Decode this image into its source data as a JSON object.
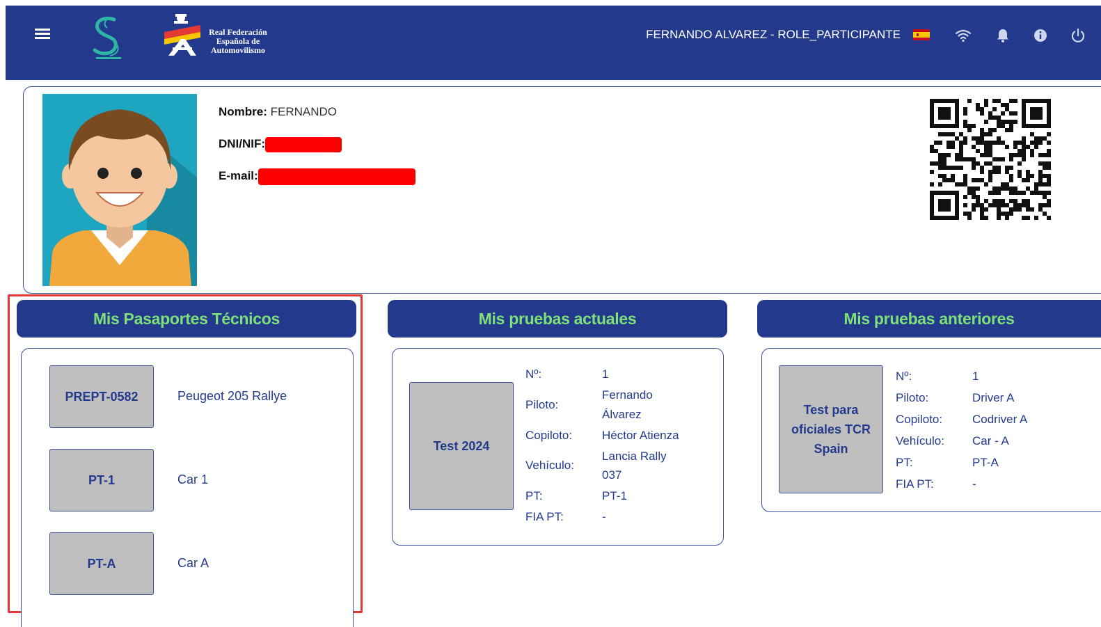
{
  "header": {
    "user_label": "FERNANDO ALVAREZ - ROLE_PARTICIPANTE",
    "logo_text_lines": [
      "Real Federación",
      "Española de",
      "Automovilismo"
    ],
    "icons": [
      "menu-icon",
      "wifi-icon",
      "bell-icon",
      "info-icon",
      "power-icon"
    ],
    "bg_color": "#233a8c"
  },
  "profile": {
    "nombre_label": "Nombre:",
    "nombre_value": "FERNANDO",
    "dni_label": "DNI/NIF:",
    "email_label": "E-mail:"
  },
  "sections": {
    "pasaportes": {
      "title": "Mis Pasaportes Técnicos",
      "items": [
        {
          "code": "PREPT-0582",
          "name": "Peugeot 205 Rallye"
        },
        {
          "code": "PT-1",
          "name": "Car 1"
        },
        {
          "code": "PT-A",
          "name": "Car A"
        }
      ]
    },
    "actuales": {
      "title": "Mis pruebas actuales",
      "test_name": "Test 2024",
      "labels": {
        "num": "Nº:",
        "piloto": "Piloto:",
        "copiloto": "Copiloto:",
        "vehiculo": "Vehículo:",
        "pt": "PT:",
        "fia_pt": "FIA PT:"
      },
      "values": {
        "num": "1",
        "piloto_1": "Fernando",
        "piloto_2": "Álvarez",
        "copiloto": "Héctor Atienza",
        "vehiculo_1": "Lancia Rally",
        "vehiculo_2": "037",
        "pt": "PT-1",
        "fia_pt": "-"
      }
    },
    "anteriores": {
      "title": "Mis pruebas anteriores",
      "test_name_lines": [
        "Test para",
        "oficiales TCR",
        "Spain"
      ],
      "labels": {
        "num": "Nº:",
        "piloto": "Piloto:",
        "copiloto": "Copiloto:",
        "vehiculo": "Vehículo:",
        "pt": "PT:",
        "fia_pt": "FIA PT:"
      },
      "values": {
        "num": "1",
        "piloto": "Driver A",
        "copiloto": "Codriver A",
        "vehiculo": "Car - A",
        "pt": "PT-A",
        "fia_pt": "-"
      }
    }
  },
  "colors": {
    "accent_green": "#7fe07a",
    "highlight_red": "#e53935",
    "box_gray": "#bfbfbf"
  }
}
